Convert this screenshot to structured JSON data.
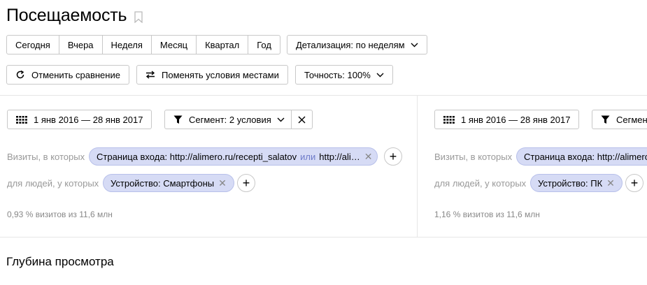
{
  "page": {
    "title": "Посещаемость"
  },
  "periods": [
    "Сегодня",
    "Вчера",
    "Неделя",
    "Месяц",
    "Квартал",
    "Год"
  ],
  "detail_label": "Детализация: по неделям",
  "cancel_compare_label": "Отменить сравнение",
  "swap_label": "Поменять условия местами",
  "accuracy_label": "Точность: 100%",
  "left": {
    "date_range": "1 янв 2016 — 28 янв 2017",
    "segment_label": "Сегмент: 2 условия",
    "visits_label": "Визиты, в которых",
    "visits_chip_a": "Страница входа: http://alimero.ru/recepti_salatov",
    "visits_chip_or": "или",
    "visits_chip_b": "http://ali…",
    "people_label": "для людей, у которых",
    "people_chip": "Устройство: Смартфоны",
    "stat": "0,93 % визитов из 11,6 млн"
  },
  "right": {
    "date_range": "1 янв 2016 — 28 янв 2017",
    "segment_label": "Сегмент",
    "visits_label": "Визиты, в которых",
    "visits_chip_a": "Страница входа: http://alimero",
    "people_label": "для людей, у которых",
    "people_chip": "Устройство: ПК",
    "stat": "1,16 % визитов из 11,6 млн"
  },
  "section_title": "Глубина просмотра"
}
